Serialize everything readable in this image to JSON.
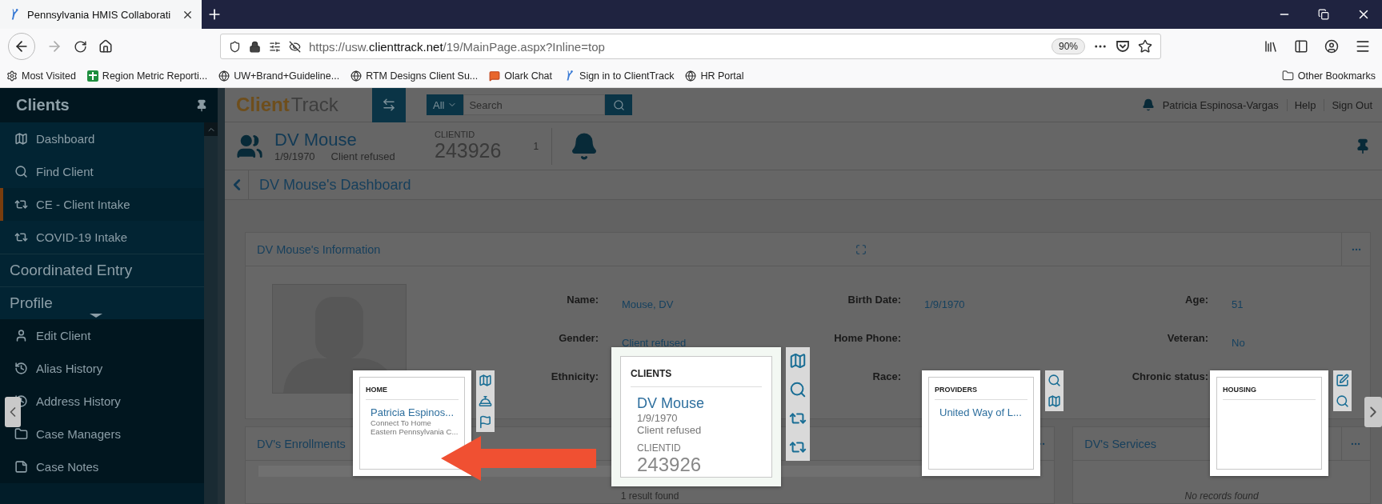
{
  "browser": {
    "tab_title": "Pennsylvania HMIS Collaborati",
    "url_prefix": "https://usw.",
    "url_host": "clienttrack.net",
    "url_path": "/19/MainPage.aspx?Inline=top",
    "zoom": "90%",
    "bookmarks": [
      {
        "label": "Most Visited",
        "kind": "gear"
      },
      {
        "label": "Region Metric Reporti...",
        "kind": "sheet"
      },
      {
        "label": "UW+Brand+Guideline...",
        "kind": "globe"
      },
      {
        "label": "RTM Designs Client Su...",
        "kind": "globe"
      },
      {
        "label": "Olark Chat",
        "kind": "chat"
      },
      {
        "label": "Sign in to ClientTrack",
        "kind": "logo"
      },
      {
        "label": "HR Portal",
        "kind": "globe"
      }
    ],
    "other_bookmarks": "Other Bookmarks"
  },
  "sidebar": {
    "title": "Clients",
    "items": [
      {
        "label": "Dashboard",
        "selected": false
      },
      {
        "label": "Find Client",
        "selected": false
      },
      {
        "label": "CE - Client Intake",
        "selected": true
      },
      {
        "label": "COVID-19 Intake",
        "selected": false
      }
    ],
    "sections": [
      {
        "title": "Coordinated Entry",
        "expanded": false
      },
      {
        "title": "Profile",
        "expanded": true,
        "items": [
          {
            "label": "Edit Client"
          },
          {
            "label": "Alias History"
          },
          {
            "label": "Address History"
          },
          {
            "label": "Case Managers"
          },
          {
            "label": "Case Notes"
          }
        ]
      }
    ]
  },
  "topbar": {
    "logo_a": "Client",
    "logo_b": "Track",
    "scope": "All",
    "search_placeholder": "Search",
    "user": "Patricia Espinosa-Vargas",
    "links": [
      "Help",
      "Sign Out"
    ]
  },
  "client": {
    "name": "DV Mouse",
    "dob": "1/9/1970",
    "status": "Client refused",
    "id_label": "CLIENTID",
    "id": "243926",
    "count": "1"
  },
  "breadcrumb": "DV Mouse's Dashboard",
  "info": {
    "title": "DV Mouse's Information",
    "fields": [
      {
        "label": "Name:",
        "value": "Mouse, DV"
      },
      {
        "label": "Birth Date:",
        "value": "1/9/1970"
      },
      {
        "label": "Age:",
        "value": "51"
      },
      {
        "label": "Gender:",
        "value": "Client refused"
      },
      {
        "label": "Home Phone:"
      },
      {
        "label": "Veteran:",
        "value": "No"
      },
      {
        "label": "Ethnicity:"
      },
      {
        "label": "Race:"
      },
      {
        "label": "Chronic status:"
      }
    ]
  },
  "panels": [
    {
      "title": "DV's Enrollments",
      "note": "1 result found"
    },
    {
      "title": "DV's Services",
      "note": "No records found"
    }
  ],
  "popups": [
    {
      "kind": "small",
      "title": "HOME",
      "link": "Patricia Espinos...",
      "lines": [
        "Connect To Home",
        "Eastern Pennsylvania C..."
      ]
    },
    {
      "kind": "large",
      "title": "CLIENTS",
      "link": "DV Mouse",
      "lines": [
        "1/9/1970",
        "Client refused"
      ],
      "id_label": "CLIENTID",
      "id": "243926"
    },
    {
      "kind": "small",
      "title": "PROVIDERS",
      "link": "United Way of L..."
    },
    {
      "kind": "small",
      "title": "HOUSING"
    }
  ]
}
